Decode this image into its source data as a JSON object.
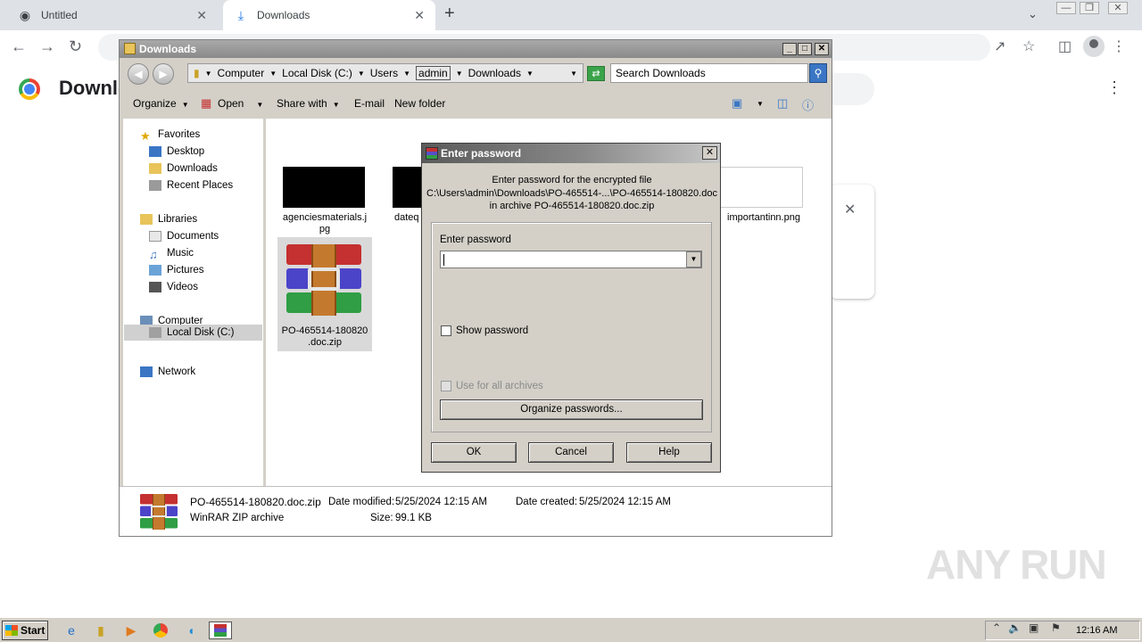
{
  "browser": {
    "tabs": [
      {
        "label": "Untitled",
        "icon": "globe-icon"
      },
      {
        "label": "Downloads",
        "icon": "download-icon"
      }
    ],
    "page_title": "Downloads"
  },
  "explorer": {
    "title": "Downloads",
    "address": {
      "segments": [
        "Computer",
        "Local Disk (C:)",
        "Users",
        "admin",
        "Downloads"
      ]
    },
    "search_placeholder": "Search Downloads",
    "commands": {
      "organize": "Organize",
      "open": "Open",
      "share": "Share with",
      "email": "E-mail",
      "new_folder": "New folder"
    },
    "nav": {
      "favorites": "Favorites",
      "desktop": "Desktop",
      "downloads": "Downloads",
      "recent": "Recent Places",
      "libraries": "Libraries",
      "documents": "Documents",
      "music": "Music",
      "pictures": "Pictures",
      "videos": "Videos",
      "computer": "Computer",
      "local_disk": "Local Disk (C:)",
      "network": "Network"
    },
    "files": {
      "f1_line1": "agenciesmaterials.j",
      "f1_line2": "pg",
      "f2": "dateq",
      "f3": "importantinn.png",
      "zip_line1": "PO-465514-180820",
      "zip_line2": ".doc.zip"
    },
    "details": {
      "name": "PO-465514-180820.doc.zip",
      "modified_label": "Date modified:",
      "modified": "5/25/2024 12:15 AM",
      "created_label": "Date created:",
      "created": "5/25/2024 12:15 AM",
      "type": "WinRAR ZIP archive",
      "size_label": "Size:",
      "size": "99.1 KB"
    }
  },
  "dialog": {
    "title": "Enter password",
    "info_line1": "Enter password for the encrypted file",
    "info_line2": "C:\\Users\\admin\\Downloads\\PO-465514-...\\PO-465514-180820.doc",
    "info_line3": "in archive PO-465514-180820.doc.zip",
    "field_label": "Enter password",
    "password_value": "",
    "show_password": "Show password",
    "use_all": "Use for all archives",
    "organize": "Organize passwords...",
    "ok": "OK",
    "cancel": "Cancel",
    "help": "Help"
  },
  "taskbar": {
    "start": "Start",
    "clock": "12:16 AM"
  },
  "watermark": "ANY RUN"
}
